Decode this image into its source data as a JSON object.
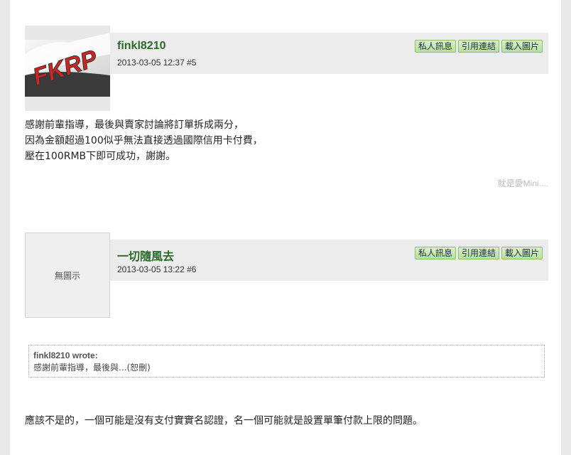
{
  "posts": [
    {
      "username": "finkl8210",
      "timestamp": "2013-03-05 12:37",
      "post_number": "#5",
      "avatar_text": "FKRP",
      "buttons": {
        "pm": "私人訊息",
        "link": "引用連結",
        "load_images": "載入圖片"
      },
      "body_lines": [
        "感謝前輩指導，最後與賣家討論將訂單拆成兩分，",
        "因為金額超過100似乎無法直接透過國際信用卡付費，",
        "壓在100RMB下即可成功，謝謝。"
      ],
      "signature": "就是愛Mini...."
    },
    {
      "username": "一切隨風去",
      "timestamp": "2013-03-05 13:22",
      "post_number": "#6",
      "avatar_text": "無圖示",
      "buttons": {
        "pm": "私人訊息",
        "link": "引用連結",
        "load_images": "載入圖片"
      },
      "quote": {
        "author": "finkl8210 wrote:",
        "text": "感謝前輩指導，最後與...(恕刪)"
      },
      "body": "應該不是的，一個可能是沒有支付實實名認證，名一個可能就是設置單筆付款上限的問題。"
    }
  ]
}
